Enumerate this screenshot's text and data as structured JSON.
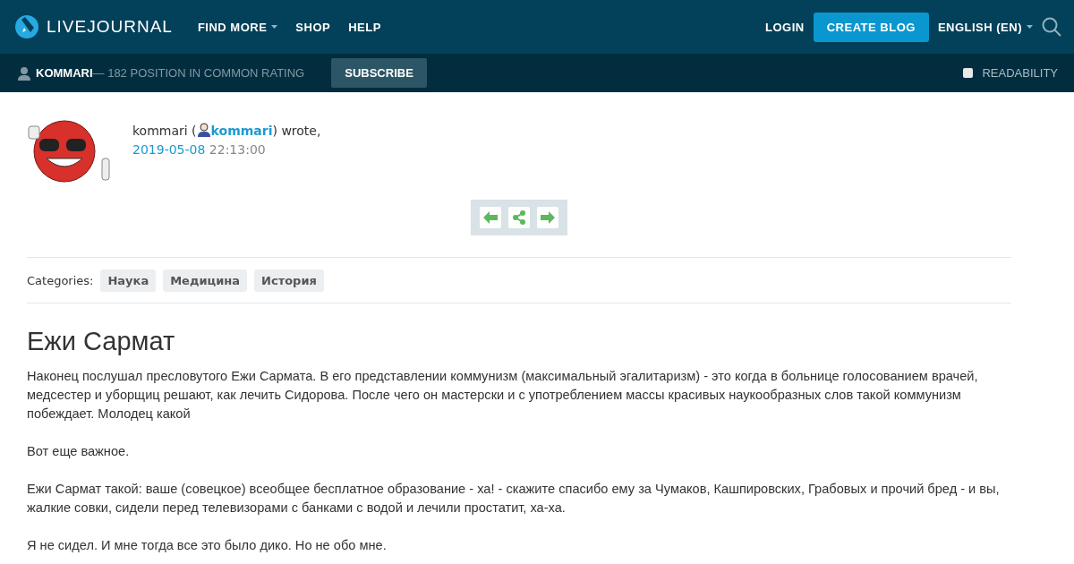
{
  "header": {
    "logo": "LIVEJOURNAL",
    "nav": [
      {
        "label": "FIND MORE",
        "dropdown": true
      },
      {
        "label": "SHOP",
        "dropdown": false
      },
      {
        "label": "HELP",
        "dropdown": false
      }
    ],
    "login": "LOGIN",
    "create_blog": "CREATE BLOG",
    "language": "ENGLISH (EN)"
  },
  "subbar": {
    "user": "KOMMARI",
    "rating": "— 182 POSITION IN COMMON RATING",
    "subscribe": "SUBSCRIBE",
    "readability": {
      "label": "READABILITY",
      "checked": false
    }
  },
  "post": {
    "author": "kommari (",
    "username": "kommari",
    "wrote": ") wrote,",
    "date": "2019-05-08",
    "time": "22:13:00",
    "categories_label": "Categories:",
    "categories": [
      "Наука",
      "Медицина",
      "История"
    ],
    "title": "Ежи Сармат",
    "paragraphs": [
      "Наконец послушал пресловутого Ежи Сармата. В его представлении коммунизм (максимальный эгалитаризм) - это когда в больнице голосованием врачей, медсестер и уборщиц решают, как лечить Сидорова. После чего он мастерски и с употреблением массы красивых наукообразных слов такой коммунизм побеждает. Молодец какой",
      "Вот еще важное.",
      "Ежи Сармат такой: ваше (совецкое) всеобщее бесплатное образование - ха! - скажите спасибо ему за Чумаков, Кашпировских, Грабовых и прочий бред - и вы, жалкие совки, сидели перед телевизорами с банками с водой и лечили простатит, ха-ха.",
      "Я не сидел. И мне тогда все это было дико. Но не обо мне."
    ]
  }
}
